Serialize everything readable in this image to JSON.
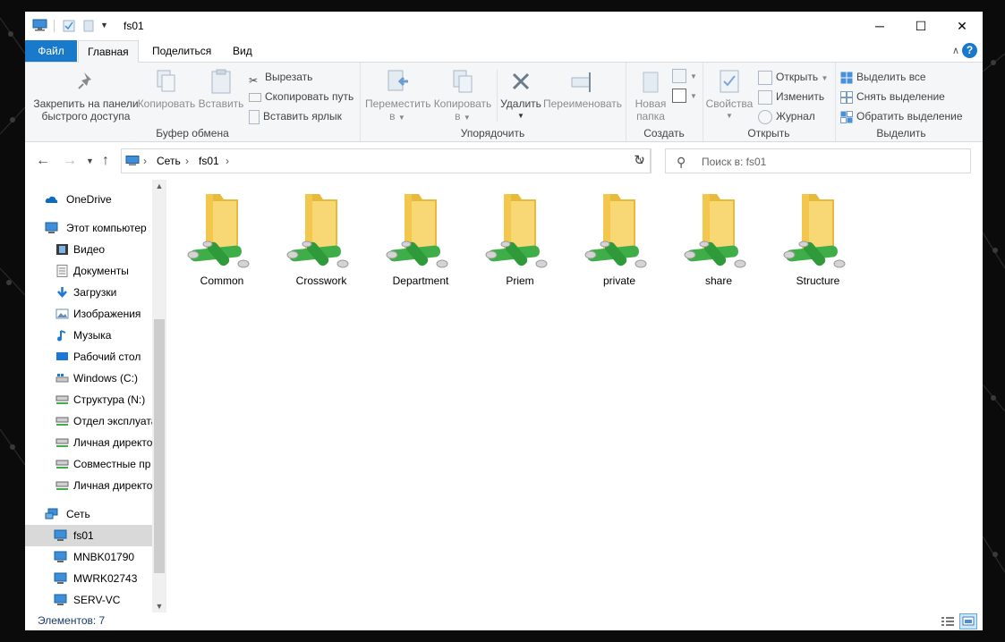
{
  "window": {
    "title": "fs01",
    "controls": {
      "minimize": "─",
      "maximize": "☐",
      "close": "✕"
    }
  },
  "ribbon_tabs": {
    "file": "Файл",
    "home": "Главная",
    "share": "Поделиться",
    "view": "Вид"
  },
  "ribbon": {
    "clipboard": {
      "pin_line1": "Закрепить на панели",
      "pin_line2": "быстрого доступа",
      "copy": "Копировать",
      "paste": "Вставить",
      "cut": "Вырезать",
      "copy_path": "Скопировать путь",
      "paste_shortcut": "Вставить ярлык",
      "group": "Буфер обмена"
    },
    "organize": {
      "move_line1": "Переместить",
      "move_line2": "в",
      "copy_line1": "Копировать",
      "copy_line2": "в",
      "delete": "Удалить",
      "rename": "Переименовать",
      "group": "Упорядочить"
    },
    "new": {
      "new_folder_line1": "Новая",
      "new_folder_line2": "папка",
      "group": "Создать"
    },
    "open": {
      "properties": "Свойства",
      "open": "Открыть",
      "edit": "Изменить",
      "history": "Журнал",
      "group": "Открыть"
    },
    "select": {
      "select_all": "Выделить все",
      "select_none": "Снять выделение",
      "invert": "Обратить выделение",
      "group": "Выделить"
    }
  },
  "address": {
    "crumbs": [
      "Сеть",
      "fs01"
    ],
    "search_placeholder": "Поиск в: fs01"
  },
  "nav": {
    "items": [
      {
        "label": "OneDrive",
        "icon": "cloud-icon"
      },
      {
        "label": "Этот компьютер",
        "icon": "computer-icon"
      },
      {
        "label": "Видео",
        "icon": "video-icon"
      },
      {
        "label": "Документы",
        "icon": "documents-icon"
      },
      {
        "label": "Загрузки",
        "icon": "download-icon"
      },
      {
        "label": "Изображения",
        "icon": "pictures-icon"
      },
      {
        "label": "Музыка",
        "icon": "music-icon"
      },
      {
        "label": "Рабочий стол",
        "icon": "desktop-icon"
      },
      {
        "label": "Windows (C:)",
        "icon": "drive-icon"
      },
      {
        "label": "Структура (N:)",
        "icon": "network-drive-icon"
      },
      {
        "label": "Отдел эксплуата",
        "icon": "network-drive-icon"
      },
      {
        "label": "Личная директо",
        "icon": "network-drive-icon"
      },
      {
        "label": "Совместные пр",
        "icon": "network-drive-icon"
      },
      {
        "label": "Личная директо",
        "icon": "network-drive-icon"
      },
      {
        "label": "Сеть",
        "icon": "network-icon"
      },
      {
        "label": "fs01",
        "icon": "computer-icon"
      },
      {
        "label": "MNBK01790",
        "icon": "computer-icon"
      },
      {
        "label": "MWRK02743",
        "icon": "computer-icon"
      },
      {
        "label": "SERV-VC",
        "icon": "computer-icon"
      }
    ]
  },
  "folders": [
    "Common",
    "Crosswork",
    "Department",
    "Priem",
    "private",
    "share",
    "Structure"
  ],
  "status": {
    "items_count": "Элементов: 7"
  },
  "colors": {
    "accent": "#1979ca",
    "folder": "#f5c842",
    "share_pipe": "#3fae49",
    "selected": "#d9d9d9"
  }
}
